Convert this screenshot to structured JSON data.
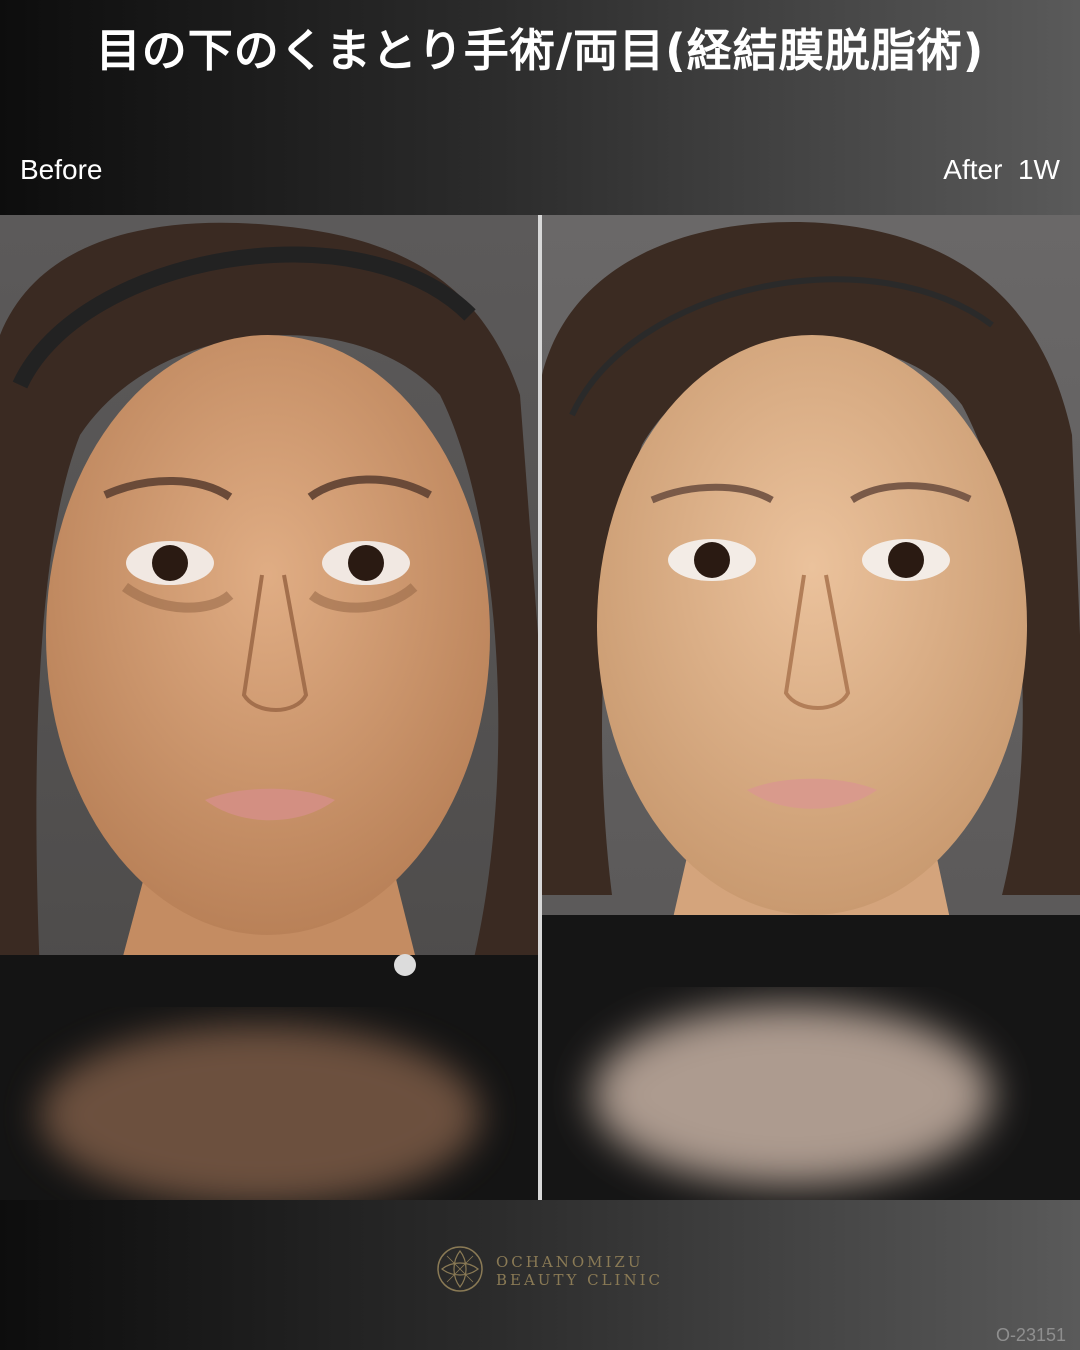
{
  "header": {
    "title": "目の下のくまとり手術/両目(経結膜脱脂術)",
    "before_label": "Before",
    "after_label": "After  1W"
  },
  "photos": {
    "before": {
      "description_icon": "face-photo-before-icon"
    },
    "after": {
      "description_icon": "face-photo-after-icon"
    }
  },
  "footer": {
    "logo_line1": "OCHANOMIZU",
    "logo_line2": "BEAUTY CLINIC",
    "case_id": "O-23151"
  },
  "colors": {
    "header_gradient_start": "#0d0d0d",
    "header_gradient_end": "#5a5a5a",
    "title_text": "#ffffff",
    "logo_gold": "#8a7a55",
    "case_id_text": "#8f8f8f"
  }
}
